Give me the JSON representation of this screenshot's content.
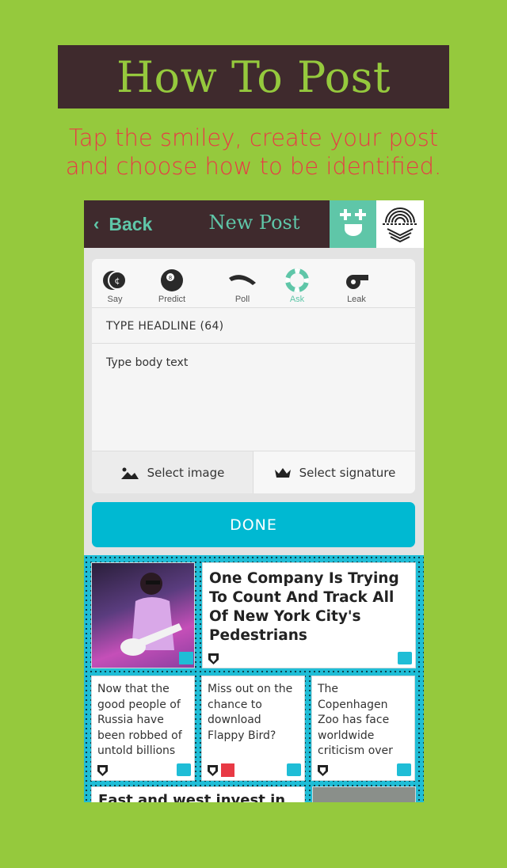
{
  "banner": {
    "title": "How To Post"
  },
  "subtitle": {
    "line1": "Tap the smiley, create your post",
    "line2": "and choose how to be identified."
  },
  "navbar": {
    "back_label": "Back",
    "title": "New Post"
  },
  "post_types": [
    {
      "label": "Say",
      "icon": "coin-icon"
    },
    {
      "label": "Predict",
      "icon": "eight-ball-icon"
    },
    {
      "label": "Poll",
      "icon": "boomerang-icon"
    },
    {
      "label": "Ask",
      "icon": "lifebuoy-icon",
      "active": true
    },
    {
      "label": "Leak",
      "icon": "whistle-icon"
    }
  ],
  "composer": {
    "headline_placeholder": "TYPE HEADLINE (64)",
    "body_placeholder": "Type body text",
    "select_image_label": "Select image",
    "select_signature_label": "Select signature",
    "done_label": "DONE"
  },
  "feed": {
    "featured_title": "One Company Is Trying To Count And Track All Of New York City's Pedestrians",
    "tiles": [
      {
        "text": "Now that the good people of Russia have been robbed of untold billions"
      },
      {
        "text": "Miss out on the chance to download Flappy Bird?"
      },
      {
        "text": "The Copenhagen Zoo has face worldwide criticism over"
      }
    ],
    "bottom_title": "East and west invest in"
  },
  "colors": {
    "background": "#95c93d",
    "banner": "#3f2a2d",
    "accent_teal": "#5fc6a8",
    "done": "#00b9d2",
    "subtitle": "#e83a45"
  }
}
